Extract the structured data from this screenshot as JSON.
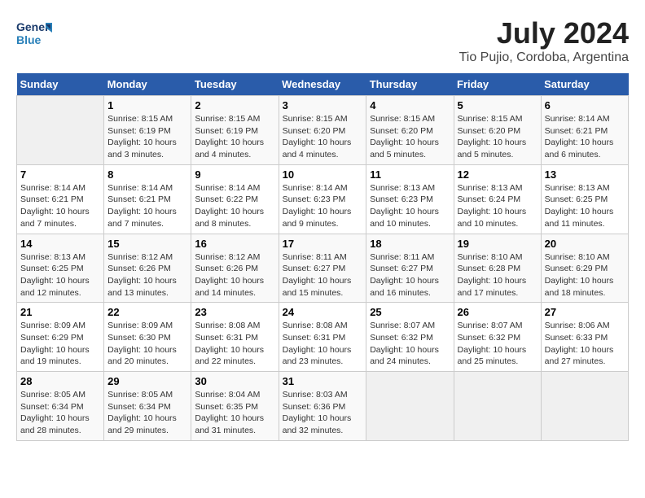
{
  "header": {
    "logo_line1": "General",
    "logo_line2": "Blue",
    "month_year": "July 2024",
    "location": "Tio Pujio, Cordoba, Argentina"
  },
  "columns": [
    "Sunday",
    "Monday",
    "Tuesday",
    "Wednesday",
    "Thursday",
    "Friday",
    "Saturday"
  ],
  "weeks": [
    [
      {
        "day": "",
        "sunrise": "",
        "sunset": "",
        "daylight": ""
      },
      {
        "day": "1",
        "sunrise": "Sunrise: 8:15 AM",
        "sunset": "Sunset: 6:19 PM",
        "daylight": "Daylight: 10 hours and 3 minutes."
      },
      {
        "day": "2",
        "sunrise": "Sunrise: 8:15 AM",
        "sunset": "Sunset: 6:19 PM",
        "daylight": "Daylight: 10 hours and 4 minutes."
      },
      {
        "day": "3",
        "sunrise": "Sunrise: 8:15 AM",
        "sunset": "Sunset: 6:20 PM",
        "daylight": "Daylight: 10 hours and 4 minutes."
      },
      {
        "day": "4",
        "sunrise": "Sunrise: 8:15 AM",
        "sunset": "Sunset: 6:20 PM",
        "daylight": "Daylight: 10 hours and 5 minutes."
      },
      {
        "day": "5",
        "sunrise": "Sunrise: 8:15 AM",
        "sunset": "Sunset: 6:20 PM",
        "daylight": "Daylight: 10 hours and 5 minutes."
      },
      {
        "day": "6",
        "sunrise": "Sunrise: 8:14 AM",
        "sunset": "Sunset: 6:21 PM",
        "daylight": "Daylight: 10 hours and 6 minutes."
      }
    ],
    [
      {
        "day": "7",
        "sunrise": "Sunrise: 8:14 AM",
        "sunset": "Sunset: 6:21 PM",
        "daylight": "Daylight: 10 hours and 7 minutes."
      },
      {
        "day": "8",
        "sunrise": "Sunrise: 8:14 AM",
        "sunset": "Sunset: 6:21 PM",
        "daylight": "Daylight: 10 hours and 7 minutes."
      },
      {
        "day": "9",
        "sunrise": "Sunrise: 8:14 AM",
        "sunset": "Sunset: 6:22 PM",
        "daylight": "Daylight: 10 hours and 8 minutes."
      },
      {
        "day": "10",
        "sunrise": "Sunrise: 8:14 AM",
        "sunset": "Sunset: 6:23 PM",
        "daylight": "Daylight: 10 hours and 9 minutes."
      },
      {
        "day": "11",
        "sunrise": "Sunrise: 8:13 AM",
        "sunset": "Sunset: 6:23 PM",
        "daylight": "Daylight: 10 hours and 10 minutes."
      },
      {
        "day": "12",
        "sunrise": "Sunrise: 8:13 AM",
        "sunset": "Sunset: 6:24 PM",
        "daylight": "Daylight: 10 hours and 10 minutes."
      },
      {
        "day": "13",
        "sunrise": "Sunrise: 8:13 AM",
        "sunset": "Sunset: 6:25 PM",
        "daylight": "Daylight: 10 hours and 11 minutes."
      }
    ],
    [
      {
        "day": "14",
        "sunrise": "Sunrise: 8:13 AM",
        "sunset": "Sunset: 6:25 PM",
        "daylight": "Daylight: 10 hours and 12 minutes."
      },
      {
        "day": "15",
        "sunrise": "Sunrise: 8:12 AM",
        "sunset": "Sunset: 6:26 PM",
        "daylight": "Daylight: 10 hours and 13 minutes."
      },
      {
        "day": "16",
        "sunrise": "Sunrise: 8:12 AM",
        "sunset": "Sunset: 6:26 PM",
        "daylight": "Daylight: 10 hours and 14 minutes."
      },
      {
        "day": "17",
        "sunrise": "Sunrise: 8:11 AM",
        "sunset": "Sunset: 6:27 PM",
        "daylight": "Daylight: 10 hours and 15 minutes."
      },
      {
        "day": "18",
        "sunrise": "Sunrise: 8:11 AM",
        "sunset": "Sunset: 6:27 PM",
        "daylight": "Daylight: 10 hours and 16 minutes."
      },
      {
        "day": "19",
        "sunrise": "Sunrise: 8:10 AM",
        "sunset": "Sunset: 6:28 PM",
        "daylight": "Daylight: 10 hours and 17 minutes."
      },
      {
        "day": "20",
        "sunrise": "Sunrise: 8:10 AM",
        "sunset": "Sunset: 6:29 PM",
        "daylight": "Daylight: 10 hours and 18 minutes."
      }
    ],
    [
      {
        "day": "21",
        "sunrise": "Sunrise: 8:09 AM",
        "sunset": "Sunset: 6:29 PM",
        "daylight": "Daylight: 10 hours and 19 minutes."
      },
      {
        "day": "22",
        "sunrise": "Sunrise: 8:09 AM",
        "sunset": "Sunset: 6:30 PM",
        "daylight": "Daylight: 10 hours and 20 minutes."
      },
      {
        "day": "23",
        "sunrise": "Sunrise: 8:08 AM",
        "sunset": "Sunset: 6:31 PM",
        "daylight": "Daylight: 10 hours and 22 minutes."
      },
      {
        "day": "24",
        "sunrise": "Sunrise: 8:08 AM",
        "sunset": "Sunset: 6:31 PM",
        "daylight": "Daylight: 10 hours and 23 minutes."
      },
      {
        "day": "25",
        "sunrise": "Sunrise: 8:07 AM",
        "sunset": "Sunset: 6:32 PM",
        "daylight": "Daylight: 10 hours and 24 minutes."
      },
      {
        "day": "26",
        "sunrise": "Sunrise: 8:07 AM",
        "sunset": "Sunset: 6:32 PM",
        "daylight": "Daylight: 10 hours and 25 minutes."
      },
      {
        "day": "27",
        "sunrise": "Sunrise: 8:06 AM",
        "sunset": "Sunset: 6:33 PM",
        "daylight": "Daylight: 10 hours and 27 minutes."
      }
    ],
    [
      {
        "day": "28",
        "sunrise": "Sunrise: 8:05 AM",
        "sunset": "Sunset: 6:34 PM",
        "daylight": "Daylight: 10 hours and 28 minutes."
      },
      {
        "day": "29",
        "sunrise": "Sunrise: 8:05 AM",
        "sunset": "Sunset: 6:34 PM",
        "daylight": "Daylight: 10 hours and 29 minutes."
      },
      {
        "day": "30",
        "sunrise": "Sunrise: 8:04 AM",
        "sunset": "Sunset: 6:35 PM",
        "daylight": "Daylight: 10 hours and 31 minutes."
      },
      {
        "day": "31",
        "sunrise": "Sunrise: 8:03 AM",
        "sunset": "Sunset: 6:36 PM",
        "daylight": "Daylight: 10 hours and 32 minutes."
      },
      {
        "day": "",
        "sunrise": "",
        "sunset": "",
        "daylight": ""
      },
      {
        "day": "",
        "sunrise": "",
        "sunset": "",
        "daylight": ""
      },
      {
        "day": "",
        "sunrise": "",
        "sunset": "",
        "daylight": ""
      }
    ]
  ]
}
